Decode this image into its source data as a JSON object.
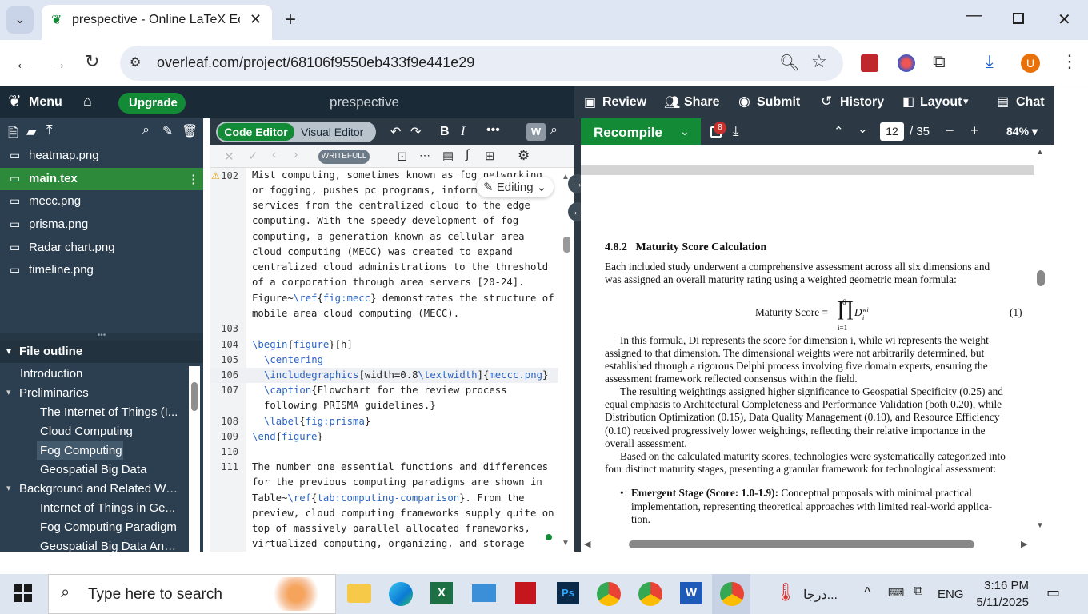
{
  "browser": {
    "tab_title": "prespective - Online LaTeX Edito",
    "url": "overleaf.com/project/68106f9550eb433f9e441e29",
    "profile_initial": "U"
  },
  "header": {
    "menu": "Menu",
    "upgrade": "Upgrade",
    "project_title": "prespective",
    "review": "Review",
    "share": "Share",
    "submit": "Submit",
    "history": "History",
    "layout": "Layout",
    "chat": "Chat"
  },
  "editor_toolbar": {
    "code_editor": "Code Editor",
    "visual_editor": "Visual Editor",
    "recompile": "Recompile",
    "writefull": "WRITEFULL",
    "editing": "Editing",
    "error_count": "8",
    "page_current": "12",
    "page_total": "/ 35",
    "zoom": "84%"
  },
  "files": [
    "heatmap.png",
    "main.tex",
    "mecc.png",
    "prisma.png",
    "Radar chart.png",
    "timeline.png"
  ],
  "outline": {
    "title": "File outline",
    "items": [
      "Introduction",
      "Preliminaries",
      "The Internet of Things (I...",
      "Cloud Computing",
      "Fog Computing",
      "Geospatial Big Data",
      "Background and Related Wo...",
      "Internet of Things in Ge...",
      "Fog Computing Paradigm",
      "Geospatial Big Data Ana..."
    ]
  },
  "code": {
    "line_numbers": [
      "102",
      "103",
      "104",
      "105",
      "106",
      "107",
      "108",
      "109",
      "110",
      "111"
    ],
    "l102": [
      "Mist computing, sometimes known as fog networking",
      "or fogging, pushes pc programs, informa",
      "services from the centralized cloud to the edge",
      "computing. With the speedy development of fog",
      "computing, a generation known as cellular area",
      "cloud computing (MECC) was created to expand",
      "centralized cloud administrations to the threshold",
      "of a corporation through area servers [20-24].",
      "Figure~",
      "\\ref",
      "{",
      "fig:mecc",
      "} demonstrates the structure of",
      "mobile area cloud computing (MECC)."
    ],
    "l104": [
      "\\begin",
      "{",
      "figure",
      "}[h]"
    ],
    "l105": "\\centering",
    "l106": [
      "\\includegraphics",
      "[width=0.8",
      "\\textwidth",
      "]{",
      "mecc",
      "c.png",
      "}"
    ],
    "l107a": [
      "\\caption",
      "{Flowchart for the review process"
    ],
    "l107b": "following PRISMA guidelines.}",
    "l108": [
      "\\label",
      "{",
      "fig:prisma",
      "}"
    ],
    "l109": [
      "\\end",
      "{",
      "figure",
      "}"
    ],
    "l111": [
      "The number one essential functions and differences",
      "for the previous computing paradigms are shown in",
      "Table~",
      "\\ref",
      "{",
      "tab:computing-comparison",
      "}. From the",
      "preview, cloud computing frameworks supply quite on",
      "top of massively parallel allocated frameworks,",
      "virtualized computing, organizing, and storage"
    ]
  },
  "pdf": {
    "section": "4.8.2   Maturity Score Calculation",
    "p1": [
      "Each included study underwent a comprehensive assessment across all six dimensions and",
      "was assigned an overall maturity rating using a weighted geometric mean formula:"
    ],
    "eq_label": "Maturity Score =",
    "eq_top": "6",
    "eq_bottom": "i=1",
    "eq_term": "D",
    "eq_sup": "wi",
    "eq_sub": "i",
    "eq_num": "(1)",
    "p2": [
      "In this formula, Di represents the score for dimension i, while wi represents the weight",
      "assigned to that dimension. The dimensional weights were not arbitrarily determined, but",
      "established through a rigorous Delphi process involving five domain experts, ensuring the",
      "assessment framework reflected consensus within the field."
    ],
    "p3": [
      "The resulting weightings assigned higher significance to Geospatial Specificity (0.25) and",
      "equal emphasis to Architectural Completeness and Performance Validation (both 0.20), while",
      "Distribution Optimization (0.15), Data Quality Management (0.10), and Resource Efficiency",
      "(0.10) received progressively lower weightings, reflecting their relative importance in the",
      "overall assessment."
    ],
    "p4": [
      "Based on the calculated maturity scores, technologies were systematically categorized into",
      "four distinct maturity stages, presenting a granular framework for technological assessment:"
    ],
    "bullet_head": "Emergent Stage (Score: 1.0-1.9):",
    "bullet": [
      "Conceptual proposals with minimal practical",
      "implementation, representing theoretical approaches with limited real-world applica-",
      "tion."
    ]
  },
  "taskbar": {
    "search_placeholder": "Type here to search",
    "weather": "درجا...",
    "lang": "ENG",
    "time": "3:16 PM",
    "date": "5/11/2025"
  }
}
